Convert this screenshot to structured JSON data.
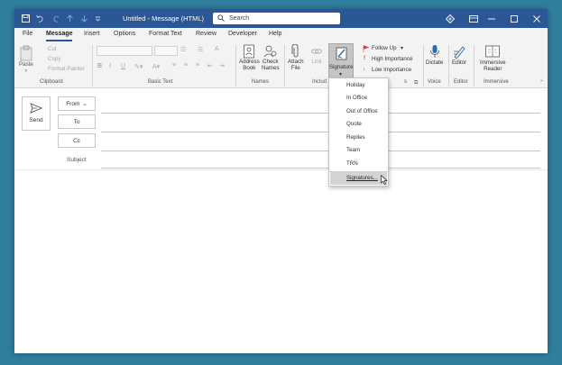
{
  "titlebar": {
    "title": "Untitled  -  Message (HTML)",
    "search_placeholder": "Search"
  },
  "tabs": [
    "File",
    "Message",
    "Insert",
    "Options",
    "Format Text",
    "Review",
    "Developer",
    "Help"
  ],
  "active_tab": "Message",
  "ribbon": {
    "clipboard": {
      "paste": "Paste",
      "cut": "Cut",
      "copy": "Copy",
      "format_painter": "Format Painter",
      "label": "Clipboard"
    },
    "basic_text": {
      "label": "Basic Text",
      "bold": "B",
      "italic": "I",
      "underline": "U"
    },
    "names": {
      "address_book": "Address\nBook",
      "check_names": "Check\nNames",
      "label": "Names"
    },
    "include": {
      "attach_file": "Attach\nFile",
      "link": "Link",
      "signature": "Signature",
      "label": "Includ"
    },
    "tags": {
      "follow_up": "Follow Up",
      "high_importance": "High Importance",
      "low_importance": "Low Importance",
      "label": "s"
    },
    "voice": {
      "dictate": "Dictate",
      "label": "Voice"
    },
    "editor": {
      "editor": "Editor",
      "label": "Editor"
    },
    "immersive": {
      "reader": "Immersive\nReader",
      "label": "Immersive"
    }
  },
  "compose": {
    "send": "Send",
    "from": "From",
    "to": "To",
    "cc": "Cc",
    "subject": "Subject"
  },
  "signature_menu": {
    "items": [
      "Holiday",
      "In Office",
      "Out of Office",
      "Quote",
      "Replies",
      "Team",
      "TRN"
    ],
    "signatures": "Signatures..."
  },
  "colors": {
    "desktop": "#2f7e9c",
    "titlebar": "#2b5797",
    "accent": "#2b5797",
    "follow_up_flag": "#e03a3a",
    "high_importance": "#d32f2f",
    "low_importance": "#2b6cb0"
  }
}
